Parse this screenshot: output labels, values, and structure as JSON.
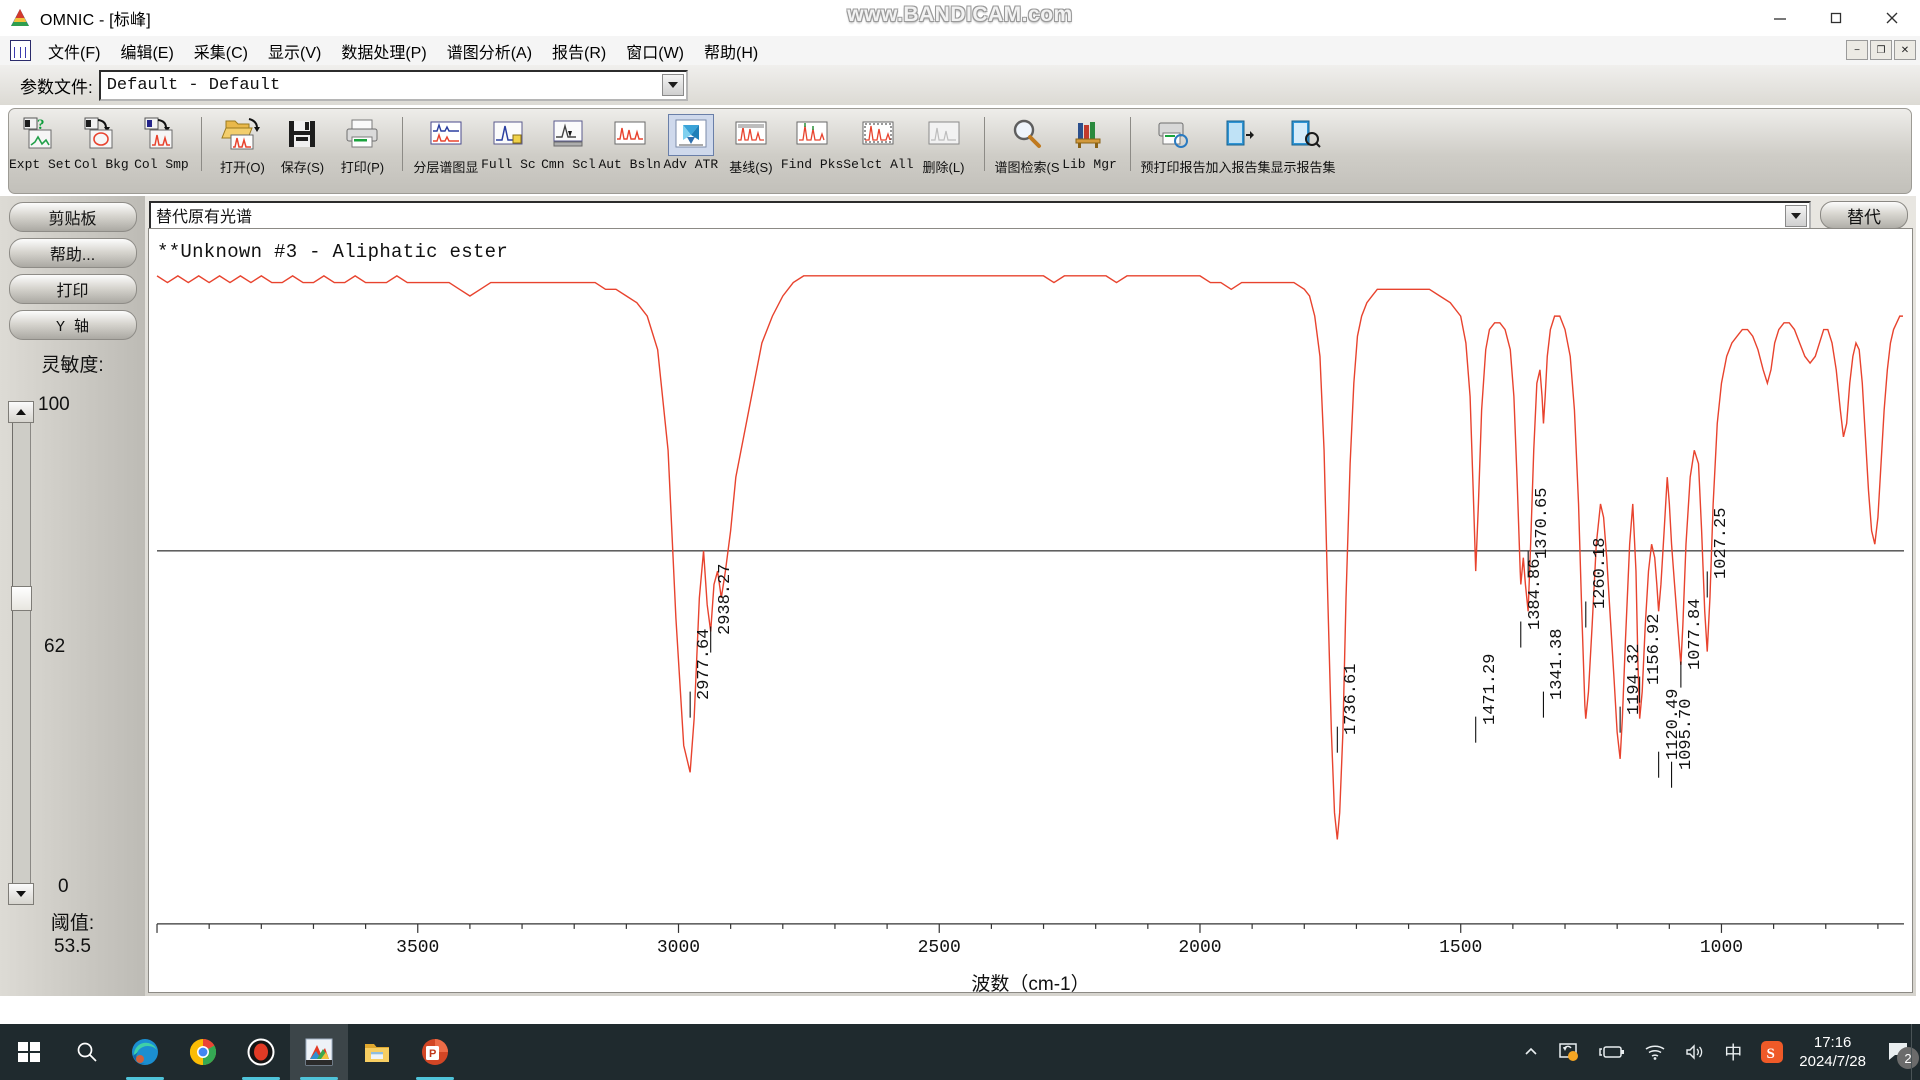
{
  "window": {
    "title": "OMNIC - [标峰]",
    "watermark": "www.BANDICAM.com",
    "minimize": "minimize-icon",
    "maximize": "maximize-icon",
    "close": "close-icon"
  },
  "menubar": {
    "items": [
      {
        "label": "文件(F)"
      },
      {
        "label": "编辑(E)"
      },
      {
        "label": "采集(C)"
      },
      {
        "label": "显示(V)"
      },
      {
        "label": "数据处理(P)"
      },
      {
        "label": "谱图分析(A)"
      },
      {
        "label": "报告(R)"
      },
      {
        "label": "窗口(W)"
      },
      {
        "label": "帮助(H)"
      }
    ],
    "mdi_buttons": [
      "−",
      "❐",
      "✕"
    ]
  },
  "param_row": {
    "label": "参数文件:",
    "value": "Default - Default",
    "dropdown_icon": "chevron-down-icon"
  },
  "toolbar": {
    "items": [
      {
        "label": "Expt Set",
        "icon": "experiment-setup-icon",
        "sep_after": false
      },
      {
        "label": "Col Bkg",
        "icon": "collect-background-icon",
        "sep_after": false
      },
      {
        "label": "Col Smp",
        "icon": "collect-sample-icon",
        "sep_after": true
      },
      {
        "label": "打开(O)",
        "icon": "open-folder-icon",
        "sep_after": false
      },
      {
        "label": "保存(S)",
        "icon": "save-disk-icon",
        "sep_after": false
      },
      {
        "label": "打印(P)",
        "icon": "print-icon",
        "sep_after": true
      },
      {
        "label": "分层谱图显",
        "icon": "stacked-spectra-icon",
        "sep_after": false
      },
      {
        "label": "Full Sc",
        "icon": "full-scale-icon",
        "sep_after": false
      },
      {
        "label": "Cmn Scl",
        "icon": "common-scale-icon",
        "sep_after": false
      },
      {
        "label": "Aut Bsln",
        "icon": "auto-baseline-icon",
        "sep_after": false
      },
      {
        "label": "Adv ATR",
        "icon": "advanced-atr-icon",
        "sep_after": false,
        "selected": true
      },
      {
        "label": "基线(S)",
        "icon": "baseline-icon",
        "sep_after": false
      },
      {
        "label": "Find Pks",
        "icon": "find-peaks-icon",
        "sep_after": false
      },
      {
        "label": "Selct All",
        "icon": "select-all-icon",
        "sep_after": false
      },
      {
        "label": "删除(L)",
        "icon": "delete-icon",
        "sep_after": true
      },
      {
        "label": "谱图检索(S",
        "icon": "search-library-icon",
        "sep_after": false
      },
      {
        "label": "Lib Mgr",
        "icon": "library-manager-icon",
        "sep_after": true
      },
      {
        "label": "预打印报告",
        "icon": "print-preview-report-icon",
        "sep_after": false
      },
      {
        "label": "加入报告集",
        "icon": "add-to-report-icon",
        "sep_after": false
      },
      {
        "label": "显示报告集",
        "icon": "show-report-icon",
        "sep_after": false
      }
    ]
  },
  "sidebar": {
    "buttons": [
      {
        "label": "剪贴板",
        "name": "clipboard-button"
      },
      {
        "label": "帮助...",
        "name": "help-button"
      },
      {
        "label": "打印",
        "name": "print-button"
      },
      {
        "label": "Y 轴",
        "name": "y-axis-button"
      }
    ],
    "sensitivity_label": "灵敏度:",
    "slider_max": "100",
    "slider_value": "62",
    "slider_min": "0",
    "threshold_label": "阈值:",
    "threshold_value": "53.5"
  },
  "spectrum_panel": {
    "combo_value": "替代原有光谱",
    "combo_dropdown_icon": "chevron-down-icon",
    "replace_button": "替代"
  },
  "chart_data": {
    "type": "line",
    "title": "**Unknown #3 - Aliphatic ester",
    "xlabel": "波数（cm-1）",
    "ylabel": "",
    "xlim": [
      4000,
      650
    ],
    "xticks": [
      3500,
      3000,
      2500,
      2000,
      1500,
      1000
    ],
    "ylim": [
      0,
      100
    ],
    "grid": false,
    "line_color": "#e8432e",
    "baseline_color": "#000000",
    "series_name": "Unknown #3 - Aliphatic ester",
    "peaks": [
      {
        "wavenumber": 2977.64,
        "label": "2977.64"
      },
      {
        "wavenumber": 2938.27,
        "label": "2938.27"
      },
      {
        "wavenumber": 1736.61,
        "label": "1736.61"
      },
      {
        "wavenumber": 1471.29,
        "label": "1471.29"
      },
      {
        "wavenumber": 1384.86,
        "label": "1384.86"
      },
      {
        "wavenumber": 1370.65,
        "label": "1370.65"
      },
      {
        "wavenumber": 1341.38,
        "label": "1341.38"
      },
      {
        "wavenumber": 1260.18,
        "label": "1260.18"
      },
      {
        "wavenumber": 1194.32,
        "label": "1194.32"
      },
      {
        "wavenumber": 1156.92,
        "label": "1156.92"
      },
      {
        "wavenumber": 1120.49,
        "label": "1120.49"
      },
      {
        "wavenumber": 1095.7,
        "label": "1095.70"
      },
      {
        "wavenumber": 1077.84,
        "label": "1077.84"
      },
      {
        "wavenumber": 1027.25,
        "label": "1027.25"
      }
    ],
    "spectrum_points": [
      [
        4000,
        96
      ],
      [
        3980,
        95
      ],
      [
        3960,
        96
      ],
      [
        3940,
        95
      ],
      [
        3920,
        96
      ],
      [
        3900,
        95
      ],
      [
        3880,
        96
      ],
      [
        3860,
        95
      ],
      [
        3840,
        96
      ],
      [
        3820,
        95
      ],
      [
        3800,
        96
      ],
      [
        3780,
        95
      ],
      [
        3760,
        95
      ],
      [
        3740,
        96
      ],
      [
        3720,
        95
      ],
      [
        3700,
        95
      ],
      [
        3680,
        96
      ],
      [
        3660,
        95
      ],
      [
        3640,
        95
      ],
      [
        3620,
        96
      ],
      [
        3600,
        95
      ],
      [
        3580,
        95
      ],
      [
        3560,
        95
      ],
      [
        3540,
        96
      ],
      [
        3520,
        95
      ],
      [
        3500,
        95
      ],
      [
        3480,
        95
      ],
      [
        3460,
        95
      ],
      [
        3440,
        95
      ],
      [
        3420,
        94
      ],
      [
        3400,
        93
      ],
      [
        3380,
        94
      ],
      [
        3360,
        95
      ],
      [
        3340,
        95
      ],
      [
        3320,
        95
      ],
      [
        3300,
        95
      ],
      [
        3280,
        95
      ],
      [
        3260,
        95
      ],
      [
        3240,
        95
      ],
      [
        3220,
        95
      ],
      [
        3200,
        95
      ],
      [
        3180,
        95
      ],
      [
        3160,
        95
      ],
      [
        3140,
        94
      ],
      [
        3120,
        94
      ],
      [
        3100,
        93
      ],
      [
        3080,
        92
      ],
      [
        3060,
        90
      ],
      [
        3040,
        85
      ],
      [
        3020,
        70
      ],
      [
        3005,
        45
      ],
      [
        2990,
        26
      ],
      [
        2977.64,
        22
      ],
      [
        2970,
        30
      ],
      [
        2960,
        48
      ],
      [
        2952,
        55
      ],
      [
        2945,
        47
      ],
      [
        2938.27,
        43
      ],
      [
        2932,
        50
      ],
      [
        2925,
        52
      ],
      [
        2918,
        48
      ],
      [
        2910,
        52
      ],
      [
        2900,
        58
      ],
      [
        2890,
        66
      ],
      [
        2880,
        70
      ],
      [
        2870,
        74
      ],
      [
        2860,
        78
      ],
      [
        2850,
        82
      ],
      [
        2840,
        86
      ],
      [
        2820,
        90
      ],
      [
        2800,
        93
      ],
      [
        2780,
        95
      ],
      [
        2760,
        96
      ],
      [
        2740,
        96
      ],
      [
        2720,
        96
      ],
      [
        2700,
        96
      ],
      [
        2680,
        96
      ],
      [
        2660,
        96
      ],
      [
        2640,
        96
      ],
      [
        2620,
        96
      ],
      [
        2600,
        96
      ],
      [
        2580,
        96
      ],
      [
        2560,
        96
      ],
      [
        2540,
        96
      ],
      [
        2520,
        96
      ],
      [
        2500,
        96
      ],
      [
        2480,
        96
      ],
      [
        2460,
        96
      ],
      [
        2440,
        96
      ],
      [
        2420,
        96
      ],
      [
        2400,
        96
      ],
      [
        2380,
        96
      ],
      [
        2360,
        96
      ],
      [
        2340,
        96
      ],
      [
        2320,
        96
      ],
      [
        2300,
        96
      ],
      [
        2280,
        95
      ],
      [
        2260,
        96
      ],
      [
        2240,
        96
      ],
      [
        2220,
        96
      ],
      [
        2200,
        96
      ],
      [
        2180,
        96
      ],
      [
        2160,
        95
      ],
      [
        2140,
        96
      ],
      [
        2120,
        96
      ],
      [
        2100,
        96
      ],
      [
        2080,
        96
      ],
      [
        2060,
        96
      ],
      [
        2040,
        96
      ],
      [
        2020,
        96
      ],
      [
        2000,
        96
      ],
      [
        1980,
        95
      ],
      [
        1960,
        95
      ],
      [
        1940,
        94
      ],
      [
        1920,
        95
      ],
      [
        1900,
        95
      ],
      [
        1880,
        95
      ],
      [
        1860,
        95
      ],
      [
        1840,
        95
      ],
      [
        1820,
        95
      ],
      [
        1800,
        94
      ],
      [
        1790,
        93
      ],
      [
        1780,
        90
      ],
      [
        1770,
        84
      ],
      [
        1762,
        70
      ],
      [
        1755,
        48
      ],
      [
        1748,
        28
      ],
      [
        1742,
        16
      ],
      [
        1736.61,
        12
      ],
      [
        1732,
        16
      ],
      [
        1726,
        28
      ],
      [
        1720,
        48
      ],
      [
        1712,
        68
      ],
      [
        1705,
        80
      ],
      [
        1698,
        87
      ],
      [
        1690,
        90
      ],
      [
        1680,
        92
      ],
      [
        1670,
        93
      ],
      [
        1660,
        94
      ],
      [
        1650,
        94
      ],
      [
        1640,
        94
      ],
      [
        1620,
        94
      ],
      [
        1600,
        94
      ],
      [
        1580,
        94
      ],
      [
        1560,
        94
      ],
      [
        1540,
        93
      ],
      [
        1520,
        92
      ],
      [
        1500,
        90
      ],
      [
        1490,
        86
      ],
      [
        1482,
        78
      ],
      [
        1476,
        64
      ],
      [
        1471.29,
        52
      ],
      [
        1466,
        62
      ],
      [
        1460,
        76
      ],
      [
        1452,
        85
      ],
      [
        1445,
        88
      ],
      [
        1435,
        89
      ],
      [
        1425,
        89
      ],
      [
        1415,
        88
      ],
      [
        1405,
        85
      ],
      [
        1398,
        78
      ],
      [
        1392,
        66
      ],
      [
        1386,
        52
      ],
      [
        1384.86,
        50
      ],
      [
        1380,
        54
      ],
      [
        1376,
        50
      ],
      [
        1370.65,
        46
      ],
      [
        1366,
        56
      ],
      [
        1360,
        70
      ],
      [
        1354,
        80
      ],
      [
        1348,
        82
      ],
      [
        1344,
        78
      ],
      [
        1341.38,
        74
      ],
      [
        1338,
        78
      ],
      [
        1334,
        84
      ],
      [
        1328,
        88
      ],
      [
        1320,
        90
      ],
      [
        1310,
        90
      ],
      [
        1300,
        88
      ],
      [
        1290,
        84
      ],
      [
        1282,
        76
      ],
      [
        1274,
        62
      ],
      [
        1268,
        46
      ],
      [
        1262,
        32
      ],
      [
        1260.18,
        30
      ],
      [
        1255,
        34
      ],
      [
        1248,
        44
      ],
      [
        1240,
        56
      ],
      [
        1232,
        62
      ],
      [
        1226,
        60
      ],
      [
        1220,
        54
      ],
      [
        1214,
        46
      ],
      [
        1206,
        36
      ],
      [
        1200,
        28
      ],
      [
        1194.32,
        24
      ],
      [
        1190,
        30
      ],
      [
        1184,
        42
      ],
      [
        1176,
        56
      ],
      [
        1170,
        62
      ],
      [
        1164,
        52
      ],
      [
        1160,
        38
      ],
      [
        1156.92,
        30
      ],
      [
        1152,
        34
      ],
      [
        1146,
        44
      ],
      [
        1140,
        52
      ],
      [
        1134,
        56
      ],
      [
        1128,
        54
      ],
      [
        1124,
        50
      ],
      [
        1120.49,
        46
      ],
      [
        1116,
        50
      ],
      [
        1110,
        58
      ],
      [
        1104,
        66
      ],
      [
        1100,
        62
      ],
      [
        1095.7,
        56
      ],
      [
        1090,
        50
      ],
      [
        1084,
        44
      ],
      [
        1080,
        40
      ],
      [
        1077.84,
        38
      ],
      [
        1074,
        44
      ],
      [
        1068,
        56
      ],
      [
        1060,
        66
      ],
      [
        1052,
        70
      ],
      [
        1044,
        68
      ],
      [
        1038,
        58
      ],
      [
        1032,
        46
      ],
      [
        1027.25,
        40
      ],
      [
        1022,
        48
      ],
      [
        1016,
        62
      ],
      [
        1008,
        74
      ],
      [
        1000,
        80
      ],
      [
        990,
        84
      ],
      [
        980,
        86
      ],
      [
        970,
        87
      ],
      [
        960,
        88
      ],
      [
        950,
        88
      ],
      [
        940,
        87
      ],
      [
        930,
        85
      ],
      [
        920,
        82
      ],
      [
        912,
        80
      ],
      [
        905,
        82
      ],
      [
        898,
        86
      ],
      [
        890,
        88
      ],
      [
        880,
        89
      ],
      [
        870,
        89
      ],
      [
        860,
        88
      ],
      [
        850,
        86
      ],
      [
        840,
        84
      ],
      [
        830,
        83
      ],
      [
        820,
        84
      ],
      [
        812,
        86
      ],
      [
        804,
        88
      ],
      [
        796,
        88
      ],
      [
        788,
        86
      ],
      [
        780,
        82
      ],
      [
        772,
        76
      ],
      [
        766,
        72
      ],
      [
        760,
        74
      ],
      [
        754,
        80
      ],
      [
        748,
        84
      ],
      [
        742,
        86
      ],
      [
        736,
        85
      ],
      [
        730,
        80
      ],
      [
        724,
        72
      ],
      [
        718,
        64
      ],
      [
        712,
        58
      ],
      [
        706,
        56
      ],
      [
        700,
        60
      ],
      [
        694,
        68
      ],
      [
        688,
        76
      ],
      [
        682,
        82
      ],
      [
        676,
        86
      ],
      [
        670,
        88
      ],
      [
        664,
        89
      ],
      [
        658,
        90
      ],
      [
        652,
        90
      ]
    ]
  },
  "taskbar": {
    "items": [
      {
        "name": "start-button",
        "icon": "windows-logo-icon"
      },
      {
        "name": "search-button",
        "icon": "search-icon"
      },
      {
        "name": "edge-button",
        "icon": "edge-icon"
      },
      {
        "name": "chrome-button",
        "icon": "chrome-icon"
      },
      {
        "name": "recorder-button",
        "icon": "record-circle-icon"
      },
      {
        "name": "omnic-button",
        "icon": "omnic-icon"
      },
      {
        "name": "explorer-button",
        "icon": "folder-icon"
      },
      {
        "name": "powerpoint-button",
        "icon": "powerpoint-icon"
      }
    ],
    "tray": {
      "chevron": "chevron-up-icon",
      "sync": "onedrive-sync-icon",
      "battery": "battery-charging-icon",
      "wifi": "wifi-icon",
      "volume": "speaker-icon",
      "ime": "中",
      "sogou": "sogou-icon",
      "time": "17:16",
      "date": "2024/7/28",
      "notification_count": "2"
    }
  }
}
